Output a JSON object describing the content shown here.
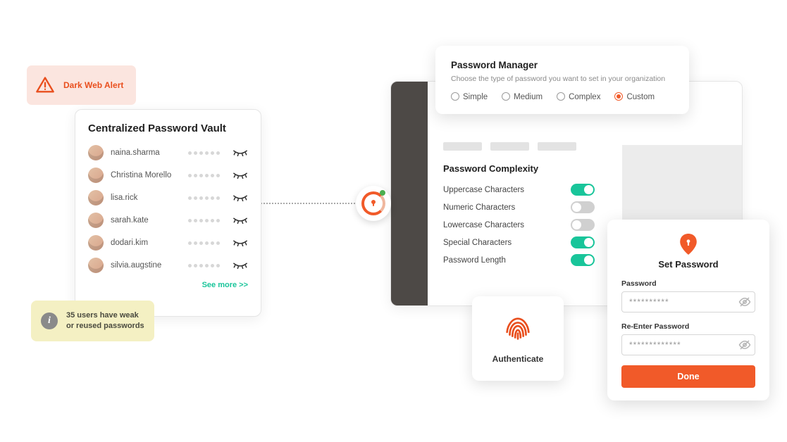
{
  "alert": {
    "title": "Dark Web Alert"
  },
  "vault": {
    "title": "Centralized Password Vault",
    "more_label": "See more >>",
    "users": [
      {
        "name": "naina.sharma"
      },
      {
        "name": "Christina Morello"
      },
      {
        "name": "lisa.rick"
      },
      {
        "name": "sarah.kate"
      },
      {
        "name": "dodari.kim"
      },
      {
        "name": "silvia.augstine"
      }
    ]
  },
  "weak_note": "35 users have weak or reused passwords",
  "password_manager": {
    "title": "Password Manager",
    "subtitle": "Choose the type of password you want to set in your organization",
    "options": [
      {
        "label": "Simple",
        "checked": false
      },
      {
        "label": "Medium",
        "checked": false
      },
      {
        "label": "Complex",
        "checked": false
      },
      {
        "label": "Custom",
        "checked": true
      }
    ]
  },
  "complexity": {
    "title": "Password Complexity",
    "rules": [
      {
        "label": "Uppercase Characters",
        "on": true
      },
      {
        "label": "Numeric Characters",
        "on": false
      },
      {
        "label": "Lowercase Characters",
        "on": false
      },
      {
        "label": "Special Characters",
        "on": true
      },
      {
        "label": "Password Length",
        "on": true
      }
    ]
  },
  "authenticate": {
    "label": "Authenticate"
  },
  "set_password": {
    "title": "Set Password",
    "field1_label": "Password",
    "field1_value": "**********",
    "field2_label": "Re-Enter Password",
    "field2_value": "*************",
    "done_label": "Done"
  }
}
